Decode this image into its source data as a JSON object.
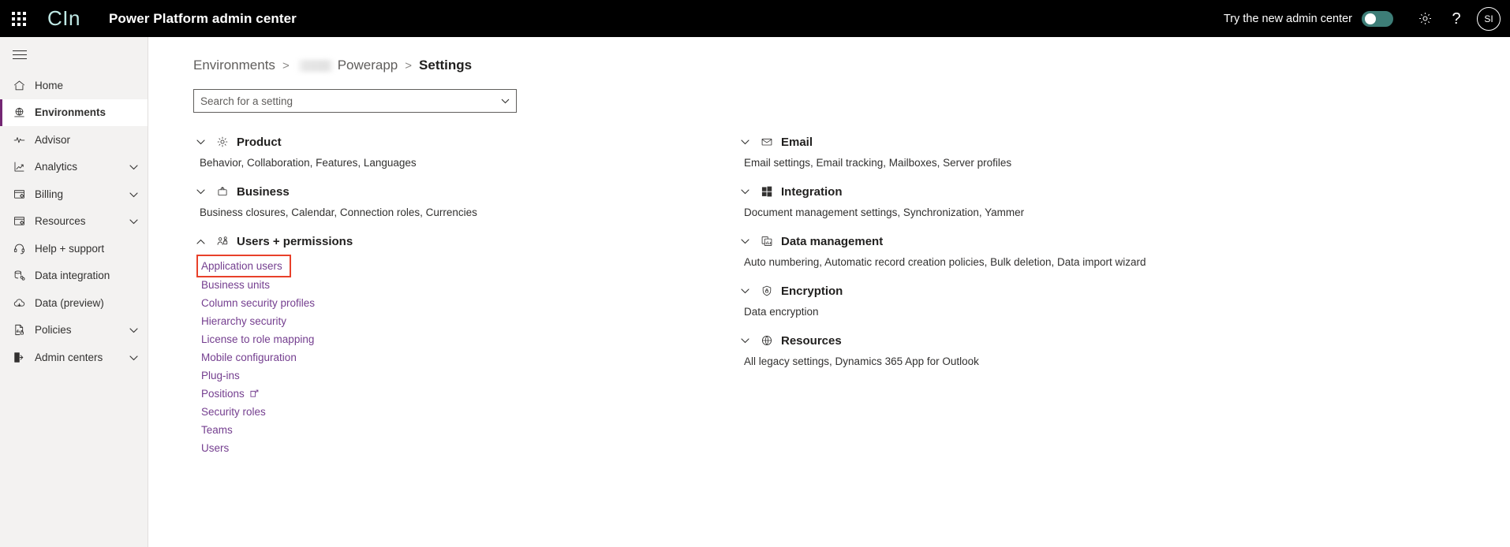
{
  "topbar": {
    "waffle_label": "app-launcher",
    "logo": "CIn",
    "title": "Power Platform admin center",
    "try_new_label": "Try the new admin center",
    "toggle_on": false,
    "gear_label": "settings",
    "help_label": "?",
    "avatar_initials": "SI",
    "background": "#000000",
    "logo_color": "#bfe8e4",
    "toggle_color": "#3d7d77"
  },
  "sidebar": {
    "hamburger_label": "global-navigation",
    "selected": "Environments",
    "accent": "#742774",
    "items": [
      {
        "label": "Home",
        "icon": "home-icon",
        "expandable": false
      },
      {
        "label": "Environments",
        "icon": "environments-icon",
        "expandable": false
      },
      {
        "label": "Advisor",
        "icon": "advisor-icon",
        "expandable": false
      },
      {
        "label": "Analytics",
        "icon": "analytics-icon",
        "expandable": true
      },
      {
        "label": "Billing",
        "icon": "billing-icon",
        "expandable": true
      },
      {
        "label": "Resources",
        "icon": "resources-icon",
        "expandable": true
      },
      {
        "label": "Help + support",
        "icon": "headset-icon",
        "expandable": false
      },
      {
        "label": "Data integration",
        "icon": "data-integration-icon",
        "expandable": false
      },
      {
        "label": "Data (preview)",
        "icon": "data-cloud-icon",
        "expandable": false
      },
      {
        "label": "Policies",
        "icon": "policies-icon",
        "expandable": true
      },
      {
        "label": "Admin centers",
        "icon": "admin-centers-icon",
        "expandable": true
      }
    ]
  },
  "breadcrumb": {
    "items": [
      {
        "label": "Environments",
        "current": false,
        "redacted": false
      },
      {
        "label": "Powerapp",
        "current": false,
        "redacted": true
      },
      {
        "label": "Settings",
        "current": true,
        "redacted": false
      }
    ]
  },
  "search": {
    "placeholder": "Search for a setting",
    "value": ""
  },
  "settings": {
    "left_column": [
      {
        "title": "Product",
        "icon": "gear-icon",
        "expanded": false,
        "description": "Behavior, Collaboration, Features, Languages",
        "links": []
      },
      {
        "title": "Business",
        "icon": "briefcase-icon",
        "expanded": false,
        "description": "Business closures, Calendar, Connection roles, Currencies",
        "links": []
      },
      {
        "title": "Users + permissions",
        "icon": "users-permissions-icon",
        "expanded": true,
        "description": "",
        "links": [
          {
            "label": "Application users",
            "highlighted": true,
            "external": false
          },
          {
            "label": "Business units",
            "highlighted": false,
            "external": false
          },
          {
            "label": "Column security profiles",
            "highlighted": false,
            "external": false
          },
          {
            "label": "Hierarchy security",
            "highlighted": false,
            "external": false
          },
          {
            "label": "License to role mapping",
            "highlighted": false,
            "external": false
          },
          {
            "label": "Mobile configuration",
            "highlighted": false,
            "external": false
          },
          {
            "label": "Plug-ins",
            "highlighted": false,
            "external": false
          },
          {
            "label": "Positions",
            "highlighted": false,
            "external": true
          },
          {
            "label": "Security roles",
            "highlighted": false,
            "external": false
          },
          {
            "label": "Teams",
            "highlighted": false,
            "external": false
          },
          {
            "label": "Users",
            "highlighted": false,
            "external": false
          }
        ]
      }
    ],
    "right_column": [
      {
        "title": "Email",
        "icon": "envelope-icon",
        "expanded": false,
        "description": "Email settings, Email tracking, Mailboxes, Server profiles",
        "links": []
      },
      {
        "title": "Integration",
        "icon": "windows-icon",
        "expanded": false,
        "description": "Document management settings, Synchronization, Yammer",
        "links": []
      },
      {
        "title": "Data management",
        "icon": "data-management-icon",
        "expanded": false,
        "description": "Auto numbering, Automatic record creation policies, Bulk deletion, Data import wizard",
        "links": []
      },
      {
        "title": "Encryption",
        "icon": "shield-lock-icon",
        "expanded": false,
        "description": "Data encryption",
        "links": []
      },
      {
        "title": "Resources",
        "icon": "globe-icon",
        "expanded": false,
        "description": "All legacy settings, Dynamics 365 App for Outlook",
        "links": []
      }
    ]
  },
  "colors": {
    "link": "#743e8f",
    "highlight_outline": "#e8402a",
    "sidebar_bg": "#f3f2f1"
  }
}
